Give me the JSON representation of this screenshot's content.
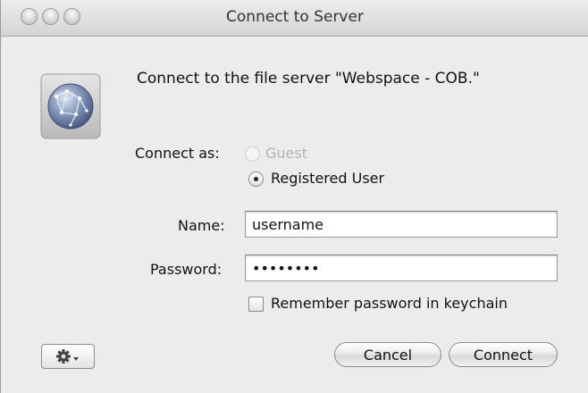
{
  "window": {
    "title": "Connect to Server"
  },
  "dialog": {
    "message": "Connect to the file server \"Webspace - COB.\"",
    "connect_as_label": "Connect as:",
    "options": {
      "guest": "Guest",
      "registered": "Registered User"
    },
    "selected_option": "Registered User",
    "name_label": "Name:",
    "name_value": "username",
    "password_label": "Password:",
    "password_value": "••••••••",
    "remember_label": "Remember password in keychain",
    "remember_checked": false
  },
  "buttons": {
    "cancel": "Cancel",
    "connect": "Connect"
  },
  "icons": {
    "server": "globe-server-icon",
    "action": "gear-icon"
  }
}
